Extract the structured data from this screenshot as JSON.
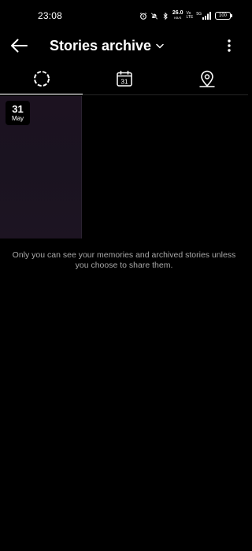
{
  "status_bar": {
    "time": "23:08",
    "net_speed_value": "26.0",
    "net_speed_unit": "KB/S",
    "volte_top": "Vo",
    "volte_bottom": "LTE",
    "signal_label": "5G",
    "battery": "100",
    "icons": [
      "alarm-icon",
      "mute-icon",
      "bluetooth-icon",
      "signal-icon",
      "battery-icon"
    ]
  },
  "header": {
    "title": "Stories archive",
    "back_icon": "arrow-left-icon",
    "dropdown_icon": "chevron-down-icon",
    "more_icon": "more-vertical-icon"
  },
  "tabs": [
    {
      "name": "stories",
      "icon": "stories-ring-icon",
      "selected": true
    },
    {
      "name": "calendar",
      "icon": "calendar-icon",
      "calendar_day": "31",
      "selected": false
    },
    {
      "name": "map",
      "icon": "location-pin-icon",
      "selected": false
    }
  ],
  "archive": {
    "items": [
      {
        "day": "31",
        "month": "May"
      }
    ],
    "info_text": "Only you can see your memories and archived stories unless you choose to share them."
  },
  "colors": {
    "background": "#000000",
    "text_primary": "#ffffff",
    "text_secondary": "#a8a8a8",
    "tile_background": "#1c1220"
  }
}
